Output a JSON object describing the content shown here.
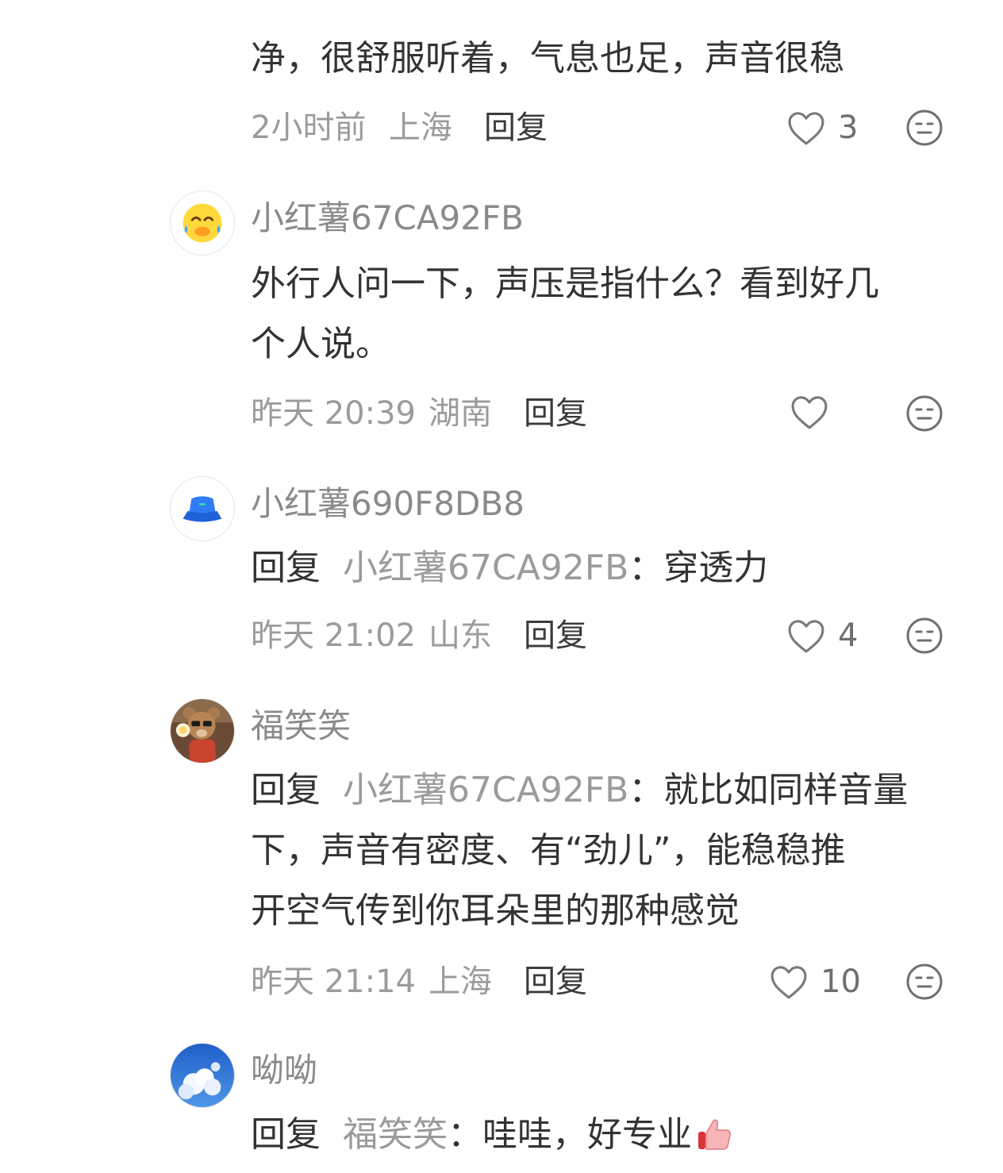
{
  "comments": [
    {
      "text": "净，很舒服听着，气息也足，声音很稳",
      "time": "2小时前",
      "location": "上海",
      "reply_label": "回复",
      "likes": "3"
    },
    {
      "username": "小红薯67CA92FB",
      "avatar_icon": "laughing-face-emoji",
      "text_lines": [
        "外行人问一下，声压是指什么？看到好几",
        "个人说。"
      ],
      "time": "昨天 20:39",
      "location": "湖南",
      "reply_label": "回复",
      "likes": ""
    },
    {
      "username": "小红薯690F8DB8",
      "avatar_icon": "blue-bucket-hat",
      "reply_prefix": "回复",
      "reply_to": "小红薯67CA92FB",
      "colon": "：",
      "text": "穿透力",
      "time": "昨天 21:02",
      "location": "山东",
      "reply_label": "回复",
      "likes": "4"
    },
    {
      "username": "福笑笑",
      "avatar_icon": "bear-with-sunglasses-photo",
      "reply_prefix": "回复",
      "reply_to": "小红薯67CA92FB",
      "colon": "：",
      "text_lines": [
        "就比如同样音量",
        "下，声音有密度、有“劲儿”，能稳稳推",
        "开空气传到你耳朵里的那种感觉"
      ],
      "time": "昨天 21:14",
      "location": "上海",
      "reply_label": "回复",
      "likes": "10"
    },
    {
      "username": "呦呦",
      "avatar_icon": "blue-sky-cloud-photo",
      "reply_prefix": "回复",
      "reply_to": "福笑笑",
      "colon": "：",
      "text": "哇哇，好专业",
      "emoji": "thumbs-up-emoji"
    }
  ],
  "colors": {
    "text": "#333333",
    "secondary": "#9b9b9b",
    "username": "#8a8a8a",
    "background": "#ffffff"
  }
}
